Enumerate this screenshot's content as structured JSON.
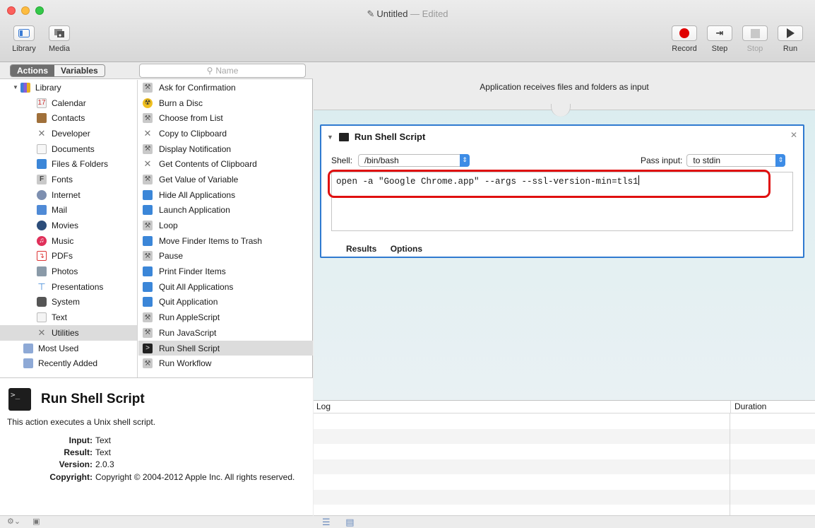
{
  "window": {
    "title": "Untitled",
    "title_sep": "—",
    "edited": "Edited"
  },
  "toolbar": {
    "library_label": "Library",
    "media_label": "Media",
    "record_label": "Record",
    "step_label": "Step",
    "stop_label": "Stop",
    "run_label": "Run"
  },
  "library": {
    "tabs": [
      "Actions",
      "Variables"
    ],
    "search_placeholder": "Name",
    "categories": [
      {
        "label": "Library",
        "icon": "library-icon"
      },
      {
        "label": "Calendar",
        "icon": "calendar-icon"
      },
      {
        "label": "Contacts",
        "icon": "contacts-icon"
      },
      {
        "label": "Developer",
        "icon": "developer-icon"
      },
      {
        "label": "Documents",
        "icon": "documents-icon"
      },
      {
        "label": "Files & Folders",
        "icon": "finder-icon"
      },
      {
        "label": "Fonts",
        "icon": "fonts-icon"
      },
      {
        "label": "Internet",
        "icon": "internet-icon"
      },
      {
        "label": "Mail",
        "icon": "mail-icon"
      },
      {
        "label": "Movies",
        "icon": "movies-icon"
      },
      {
        "label": "Music",
        "icon": "music-icon"
      },
      {
        "label": "PDFs",
        "icon": "pdf-icon"
      },
      {
        "label": "Photos",
        "icon": "photos-icon"
      },
      {
        "label": "Presentations",
        "icon": "presentations-icon"
      },
      {
        "label": "System",
        "icon": "system-icon"
      },
      {
        "label": "Text",
        "icon": "text-icon"
      },
      {
        "label": "Utilities",
        "icon": "utilities-icon"
      },
      {
        "label": "Most Used",
        "icon": "folder-icon"
      },
      {
        "label": "Recently Added",
        "icon": "folder-icon"
      }
    ],
    "actions": [
      "Ask for Confirmation",
      "Burn a Disc",
      "Choose from List",
      "Copy to Clipboard",
      "Display Notification",
      "Get Contents of Clipboard",
      "Get Value of Variable",
      "Hide All Applications",
      "Launch Application",
      "Loop",
      "Move Finder Items to Trash",
      "Pause",
      "Print Finder Items",
      "Quit All Applications",
      "Quit Application",
      "Run AppleScript",
      "Run JavaScript",
      "Run Shell Script",
      "Run Workflow"
    ]
  },
  "description": {
    "title": "Run Shell Script",
    "text": "This action executes a Unix shell script.",
    "input_key": "Input:",
    "input_val": "Text",
    "result_key": "Result:",
    "result_val": "Text",
    "version_key": "Version:",
    "version_val": "2.0.3",
    "copyright_key": "Copyright:",
    "copyright_val": "Copyright © 2004-2012 Apple Inc.  All rights reserved."
  },
  "workflow": {
    "input_banner": "Application receives files and folders as input",
    "action": {
      "title": "Run Shell Script",
      "shell_label": "Shell:",
      "shell_value": "/bin/bash",
      "pass_input_label": "Pass input:",
      "pass_input_value": "to stdin",
      "script": "open -a \"Google Chrome.app\" --args --ssl-version-min=tls1",
      "tab_results": "Results",
      "tab_options": "Options"
    }
  },
  "log": {
    "col_log": "Log",
    "col_duration": "Duration"
  },
  "colors": {
    "accent": "#2f7ad0",
    "highlight": "#e01010",
    "record": "#e00000"
  }
}
